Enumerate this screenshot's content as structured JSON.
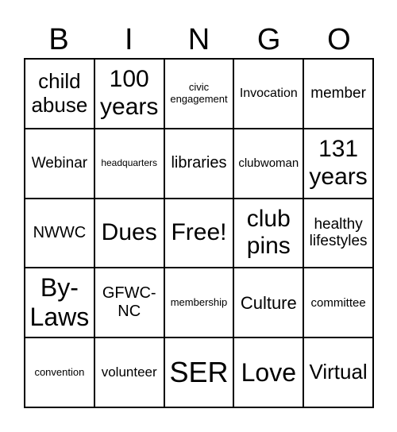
{
  "header": [
    "B",
    "I",
    "N",
    "G",
    "O"
  ],
  "cells": [
    {
      "text": "child abuse",
      "size": 26
    },
    {
      "text": "100 years",
      "size": 30
    },
    {
      "text": "civic engagement",
      "size": 13
    },
    {
      "text": "Invocation",
      "size": 16
    },
    {
      "text": "member",
      "size": 19
    },
    {
      "text": "Webinar",
      "size": 19
    },
    {
      "text": "headquarters",
      "size": 12
    },
    {
      "text": "libraries",
      "size": 20
    },
    {
      "text": "clubwoman",
      "size": 15
    },
    {
      "text": "131 years",
      "size": 30
    },
    {
      "text": "NWWC",
      "size": 20
    },
    {
      "text": "Dues",
      "size": 30
    },
    {
      "text": "Free!",
      "size": 30
    },
    {
      "text": "club pins",
      "size": 30
    },
    {
      "text": "healthy lifestyles",
      "size": 19
    },
    {
      "text": "By-Laws",
      "size": 32
    },
    {
      "text": "GFWC-NC",
      "size": 20
    },
    {
      "text": "membership",
      "size": 13
    },
    {
      "text": "Culture",
      "size": 22
    },
    {
      "text": "committee",
      "size": 15
    },
    {
      "text": "convention",
      "size": 13
    },
    {
      "text": "volunteer",
      "size": 17
    },
    {
      "text": "SER",
      "size": 36
    },
    {
      "text": "Love",
      "size": 32
    },
    {
      "text": "Virtual",
      "size": 26
    }
  ]
}
